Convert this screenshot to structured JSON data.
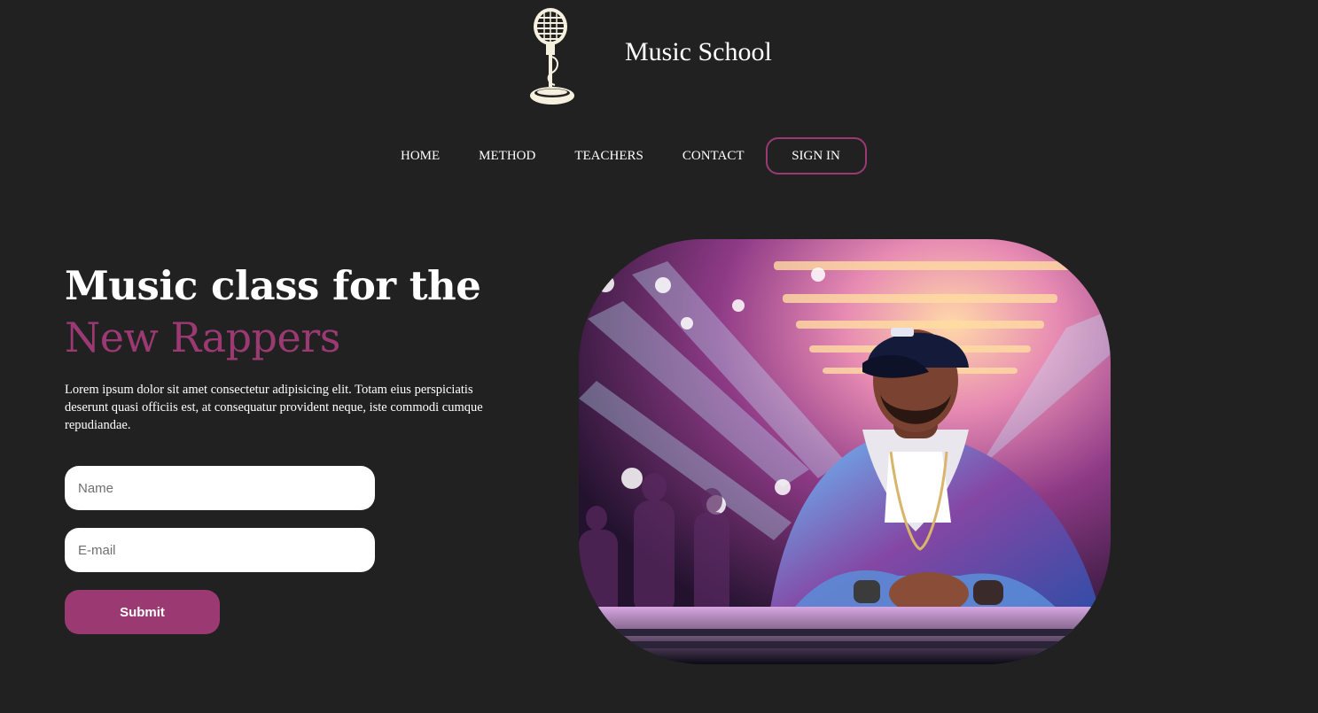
{
  "brand": {
    "name": "Music School",
    "logo_icon": "microphone-icon"
  },
  "nav": {
    "items": [
      "HOME",
      "METHOD",
      "TEACHERS",
      "CONTACT"
    ],
    "signin_label": "SIGN IN"
  },
  "hero": {
    "title_line1": "Music class for the",
    "title_line2": "New Rappers",
    "description": "Lorem ipsum dolor sit amet consectetur adipisicing elit. Totam eius perspiciatis deserunt quasi officiis est, at consequatur provident neque, iste commodi cumque repudiandae.",
    "image_icon": "rapper-photo"
  },
  "form": {
    "name_placeholder": "Name",
    "email_placeholder": "E-mail",
    "submit_label": "Submit"
  },
  "colors": {
    "background": "#212121",
    "accent": "#9b3a72",
    "text": "#ffffff",
    "logo": "#f6f1df"
  }
}
